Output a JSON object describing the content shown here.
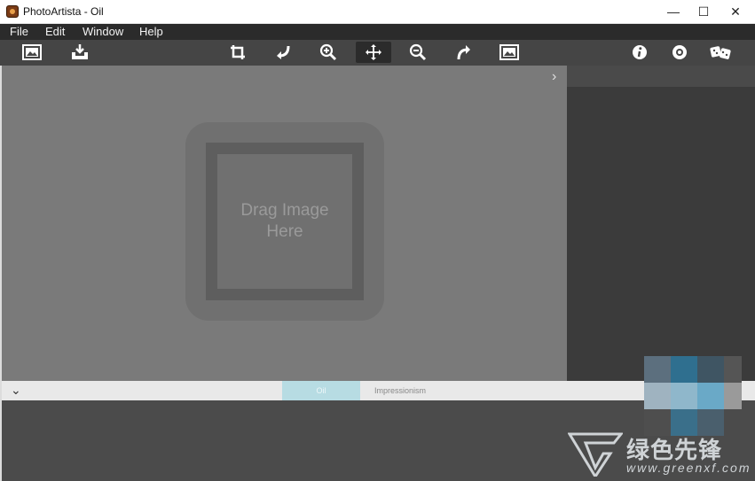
{
  "window": {
    "title": "PhotoArtista - Oil",
    "minimize": "—",
    "maximize": "☐",
    "close": "✕"
  },
  "menu": [
    "File",
    "Edit",
    "Window",
    "Help"
  ],
  "toolbar": {
    "icons": [
      "open-image-icon",
      "save-image-icon",
      "crop-icon",
      "rotate-left-icon",
      "zoom-in-icon",
      "move-icon",
      "zoom-out-icon",
      "rotate-right-icon",
      "fit-image-icon",
      "info-icon",
      "support-icon",
      "random-icon"
    ],
    "active": "move-icon"
  },
  "canvas": {
    "placeholder": "Drag Image Here",
    "expand_glyph": "›"
  },
  "filters": {
    "collapse_glyph": "⌄",
    "tabs": [
      "Oil",
      "Impressionism"
    ],
    "selected": "Oil"
  },
  "watermark": {
    "text_cn": "绿色先锋",
    "url": "www.greenxf.com"
  },
  "colors": {
    "menubar": "#2b2b2b",
    "toolbar": "#454545",
    "canvas": "#7a7a7a",
    "selected_tab": "#b7dce3"
  }
}
